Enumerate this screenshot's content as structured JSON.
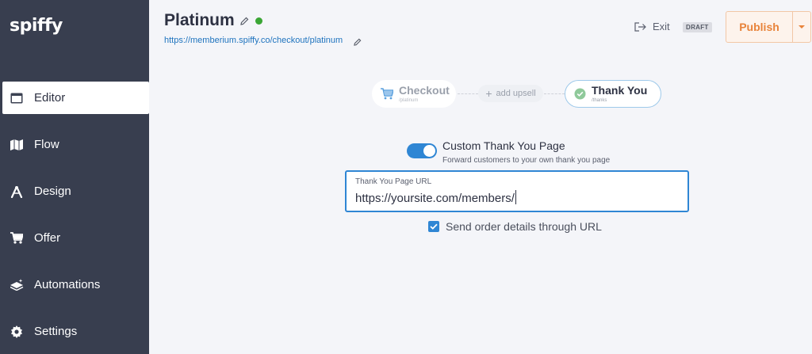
{
  "app": {
    "logo": "spiffy"
  },
  "sidebar": {
    "items": [
      {
        "label": "Editor",
        "icon": "window-icon",
        "active": true
      },
      {
        "label": "Flow",
        "icon": "map-icon"
      },
      {
        "label": "Design",
        "icon": "compass-icon"
      },
      {
        "label": "Offer",
        "icon": "cart-icon"
      },
      {
        "label": "Automations",
        "icon": "layers-icon"
      },
      {
        "label": "Settings",
        "icon": "gear-icon"
      }
    ]
  },
  "header": {
    "title": "Platinum",
    "url": "https://memberium.spiffy.co/checkout/platinum",
    "status_color": "#3aa635",
    "exit_label": "Exit",
    "draft_badge": "DRAFT",
    "publish_label": "Publish"
  },
  "flow": {
    "checkout": {
      "label": "Checkout",
      "path": "/platinum"
    },
    "upsell": {
      "label": "add upsell"
    },
    "thanks": {
      "label": "Thank You",
      "path": "/thanks"
    }
  },
  "settings": {
    "toggle_enabled": true,
    "toggle_title": "Custom Thank You Page",
    "toggle_subtitle": "Forward customers to your own thank you page",
    "field_label": "Thank You Page URL",
    "field_value": "https://yoursite.com/members/",
    "checkbox_checked": true,
    "checkbox_label": "Send order details through URL"
  },
  "colors": {
    "sidebar": "#383e4f",
    "accent": "#2f86d4",
    "publish": "#e8833a"
  }
}
